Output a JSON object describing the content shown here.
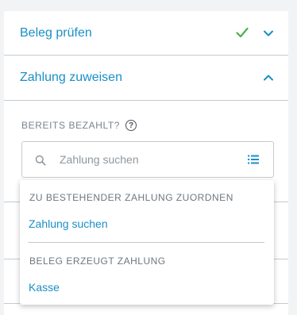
{
  "sections": {
    "beleg_pruefen": {
      "title": "Beleg prüfen",
      "status": "check-icon",
      "expanded": false
    },
    "zahlung_zuweisen": {
      "title": "Zahlung zuweisen",
      "expanded": true
    }
  },
  "payment": {
    "label": "BEREITS BEZAHLT?",
    "help_icon": "?",
    "search_placeholder": "Zahlung suchen"
  },
  "dropdown": {
    "group1_heading": "ZU BESTEHENDER ZAHLUNG ZUORDNEN",
    "group1_item": "Zahlung suchen",
    "group2_heading": "BELEG ERZEUGT ZAHLUNG",
    "group2_item": "Kasse"
  },
  "colors": {
    "accent": "#1a8fc6",
    "success": "#4caf50",
    "border": "#c5cbd0",
    "muted_text": "#7a858e"
  }
}
